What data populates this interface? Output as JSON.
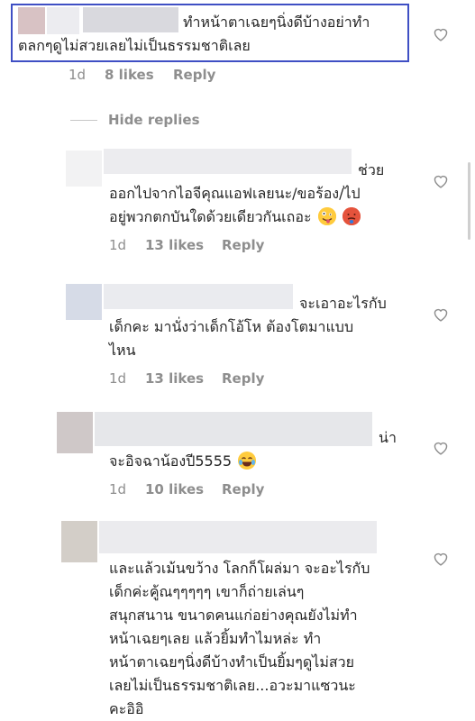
{
  "comments": [
    {
      "lines": [
        "ทำหน้าตาเฉยๆนิ่งดีบ้างอย่าทำ",
        "ตลกๆดูไม่สวยเลยไม่เป็นธรรมชาติเลย"
      ],
      "age": "1d",
      "likes": "8 likes",
      "reply": "Reply"
    },
    {
      "lines": [
        "ช่วย",
        "ออกไปจากไอจีคุณแอฟเลยนะ/ขอร้อง/ไป",
        "อยู่พวกตกบันใดด้วยเดียวกันเถอะ"
      ],
      "emojis": [
        "zany-face",
        "hot-face"
      ],
      "age": "1d",
      "likes": "13 likes",
      "reply": "Reply"
    },
    {
      "lines": [
        "จะเอาอะไรกับ",
        "เด็กคะ มานั่งว่าเด็กโอ้โห ต้องโตมาแบบ",
        "ไหน"
      ],
      "age": "1d",
      "likes": "13 likes",
      "reply": "Reply"
    },
    {
      "lines": [
        "น่า",
        "จะอิจฉาน้องปี5555"
      ],
      "emojis": [
        "tears-of-joy-face"
      ],
      "age": "1d",
      "likes": "10 likes",
      "reply": "Reply"
    },
    {
      "lines": [
        "และแล้วเม้นขว้าง โลกก็โผล่มา จะอะไรกับ",
        "เด็กค่ะคู้ณๆๆๆๆๆ เขาก็ถ่ายเล่นๆ",
        "สนุกสนาน ขนาดคนแก่อย่างคุณยังไม่ทำ",
        "หน้าเฉยๆเลย แล้วยิ้มทำไมหล่ะ ทำ",
        "หน้าตาเฉยๆนิ่งดีบ้างทำเป็นยิ้มๆดูไม่สวย",
        "เลยไม่เป็นธรรมชาติเลย...อวะมาแซวนะ",
        "คะอิอิ"
      ]
    }
  ],
  "hide_replies": "Hide replies",
  "colors": {
    "highlight_border": "#3f4fc4",
    "meta_text": "#8e8e8e",
    "body_text": "#262626"
  }
}
